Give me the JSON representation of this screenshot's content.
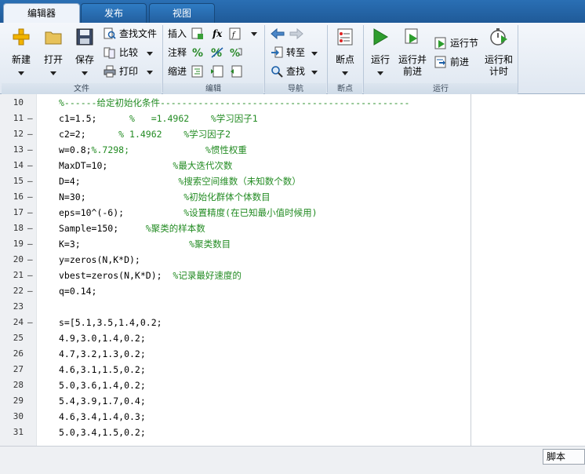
{
  "tabs": [
    {
      "label": "编辑器",
      "active": true
    },
    {
      "label": "发布",
      "active": false
    },
    {
      "label": "视图",
      "active": false
    }
  ],
  "ribbon": {
    "file": {
      "group_label": "文件",
      "new_label": "新建",
      "open_label": "打开",
      "save_label": "保存",
      "find_files_label": "查找文件",
      "compare_label": "比较",
      "print_label": "打印"
    },
    "edit": {
      "group_label": "编辑",
      "insert_label": "插入",
      "comment_label": "注释",
      "indent_label": "缩进",
      "fx_label": "fx"
    },
    "navigate": {
      "group_label": "导航",
      "goto_label": "转至",
      "find_label": "查找"
    },
    "breakpoints": {
      "group_label": "断点",
      "breakpoints_label": "断点"
    },
    "run": {
      "group_label": "运行",
      "run_label": "运行",
      "run_advance_label_1": "运行并",
      "run_advance_label_2": "前进",
      "run_section_label": "运行节",
      "advance_label": "前进",
      "run_time_label_1": "运行和",
      "run_time_label_2": "计时"
    }
  },
  "editor": {
    "lines": [
      {
        "num": "10",
        "dash": "",
        "code": "",
        "comment": "%------给定初始化条件----------------------------------------------"
      },
      {
        "num": "11",
        "dash": "—",
        "code": "c1=1.5;      ",
        "comment": "%   =1.4962    %学习因子1"
      },
      {
        "num": "12",
        "dash": "—",
        "code": "c2=2;      ",
        "comment": "% 1.4962    %学习因子2"
      },
      {
        "num": "13",
        "dash": "—",
        "code": "w=0.8;",
        "comment": "%.7298;              %惯性权重"
      },
      {
        "num": "14",
        "dash": "—",
        "code": "MaxDT=10;            ",
        "comment": "%最大迭代次数"
      },
      {
        "num": "15",
        "dash": "—",
        "code": "D=4;                  ",
        "comment": "%搜索空间维数（未知数个数）"
      },
      {
        "num": "16",
        "dash": "—",
        "code": "N=30;                  ",
        "comment": "%初始化群体个体数目"
      },
      {
        "num": "17",
        "dash": "—",
        "code": "eps=10^(-6);           ",
        "comment": "%设置精度(在已知最小值时候用)"
      },
      {
        "num": "18",
        "dash": "—",
        "code": "Sample=150;     ",
        "comment": "%聚类的样本数"
      },
      {
        "num": "19",
        "dash": "—",
        "code": "K=3;                    ",
        "comment": "%聚类数目"
      },
      {
        "num": "20",
        "dash": "—",
        "code": "y=zeros(N,K*D);",
        "comment": ""
      },
      {
        "num": "21",
        "dash": "—",
        "code": "vbest=zeros(N,K*D);  ",
        "comment": "%记录最好速度的"
      },
      {
        "num": "22",
        "dash": "—",
        "code": "q=0.14;",
        "comment": ""
      },
      {
        "num": "23",
        "dash": "",
        "code": "",
        "comment": ""
      },
      {
        "num": "24",
        "dash": "—",
        "code": "s=[5.1,3.5,1.4,0.2;",
        "comment": ""
      },
      {
        "num": "25",
        "dash": "",
        "code": "4.9,3.0,1.4,0.2;",
        "comment": ""
      },
      {
        "num": "26",
        "dash": "",
        "code": "4.7,3.2,1.3,0.2;",
        "comment": ""
      },
      {
        "num": "27",
        "dash": "",
        "code": "4.6,3.1,1.5,0.2;",
        "comment": ""
      },
      {
        "num": "28",
        "dash": "",
        "code": "5.0,3.6,1.4,0.2;",
        "comment": ""
      },
      {
        "num": "29",
        "dash": "",
        "code": "5.4,3.9,1.7,0.4;",
        "comment": ""
      },
      {
        "num": "30",
        "dash": "",
        "code": "4.6,3.4,1.4,0.3;",
        "comment": ""
      },
      {
        "num": "31",
        "dash": "",
        "code": "5.0,3.4,1.5,0.2;",
        "comment": ""
      }
    ]
  },
  "status": {
    "file_type": "脚本"
  },
  "icons": {
    "new": "plus-icon",
    "open": "folder-icon",
    "save": "floppy-icon",
    "run": "play-icon",
    "breakpoints": "breakpoint-icon"
  },
  "colors": {
    "tabbar": "#2a6fb4",
    "comment": "#228b22",
    "run_green": "#2e9d2e"
  }
}
